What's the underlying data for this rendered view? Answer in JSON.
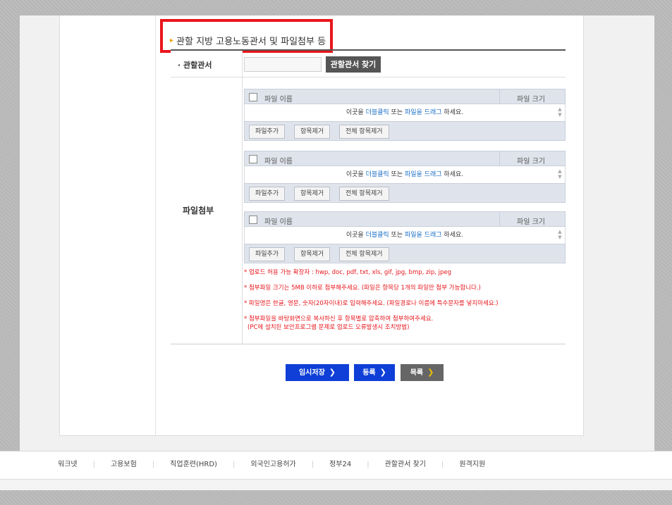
{
  "section": {
    "title": "관할 지방 고용노동관서 및 파일첨부 등"
  },
  "form": {
    "office_label": "· 관할관서",
    "office_value": "",
    "office_button": "관할관서 찾기",
    "files_label": "파일첨부"
  },
  "uploaders": [
    {
      "col_name": "파일 이름",
      "col_size": "파일 크기",
      "drop_prefix": "이곳을 ",
      "drop_dblclick": "더블클릭",
      "drop_mid": " 또는 ",
      "drop_drag": "파일을 드래그",
      "drop_suffix": " 하세요.",
      "btn_add": "파일추가",
      "btn_remove": "항목제거",
      "btn_remove_all": "전체 항목제거"
    },
    {
      "col_name": "파일 이름",
      "col_size": "파일 크기",
      "drop_prefix": "이곳을 ",
      "drop_dblclick": "더블클릭",
      "drop_mid": " 또는 ",
      "drop_drag": "파일을 드래그",
      "drop_suffix": " 하세요.",
      "btn_add": "파일추가",
      "btn_remove": "항목제거",
      "btn_remove_all": "전체 항목제거"
    },
    {
      "col_name": "파일 이름",
      "col_size": "파일 크기",
      "drop_prefix": "이곳을 ",
      "drop_dblclick": "더블클릭",
      "drop_mid": " 또는 ",
      "drop_drag": "파일을 드래그",
      "drop_suffix": " 하세요.",
      "btn_add": "파일추가",
      "btn_remove": "항목제거",
      "btn_remove_all": "전체 항목제거"
    }
  ],
  "notes": [
    "* 업로드 허용 가능 확장자 : hwp, doc, pdf, txt, xls, gif, jpg, bmp, zip, jpeg",
    "* 첨부파일 크기는 5MB 이하로 첨부해주세요. (파일은 항목당 1개의 파일만 첨부 가능합니다.)",
    "* 파일명은 한글, 영문, 숫자(20자이내)로 입력해주세요. (파일경로나 이름에 특수문자를 넣지마세요.)",
    "* 첨부파일을 바탕화면으로 복사하신 후 항목별로 압축하여 첨부하여주세요.",
    "(PC에 설치된 보안프로그램 문제로 업로드 오류발생시 조치방법)"
  ],
  "actions": {
    "temp_save": "임시저장",
    "register": "등록",
    "list": "목록"
  },
  "footer": {
    "links": [
      "워크넷",
      "고용보험",
      "직업훈련(HRD)",
      "외국인고용허가",
      "정부24",
      "관할관서 찾기",
      "원격지원"
    ]
  },
  "colors": {
    "primary_button": "#0f3fd7",
    "highlight_border": "#e8161c",
    "note_text": "#e8161c",
    "dark_button": "#555555"
  }
}
